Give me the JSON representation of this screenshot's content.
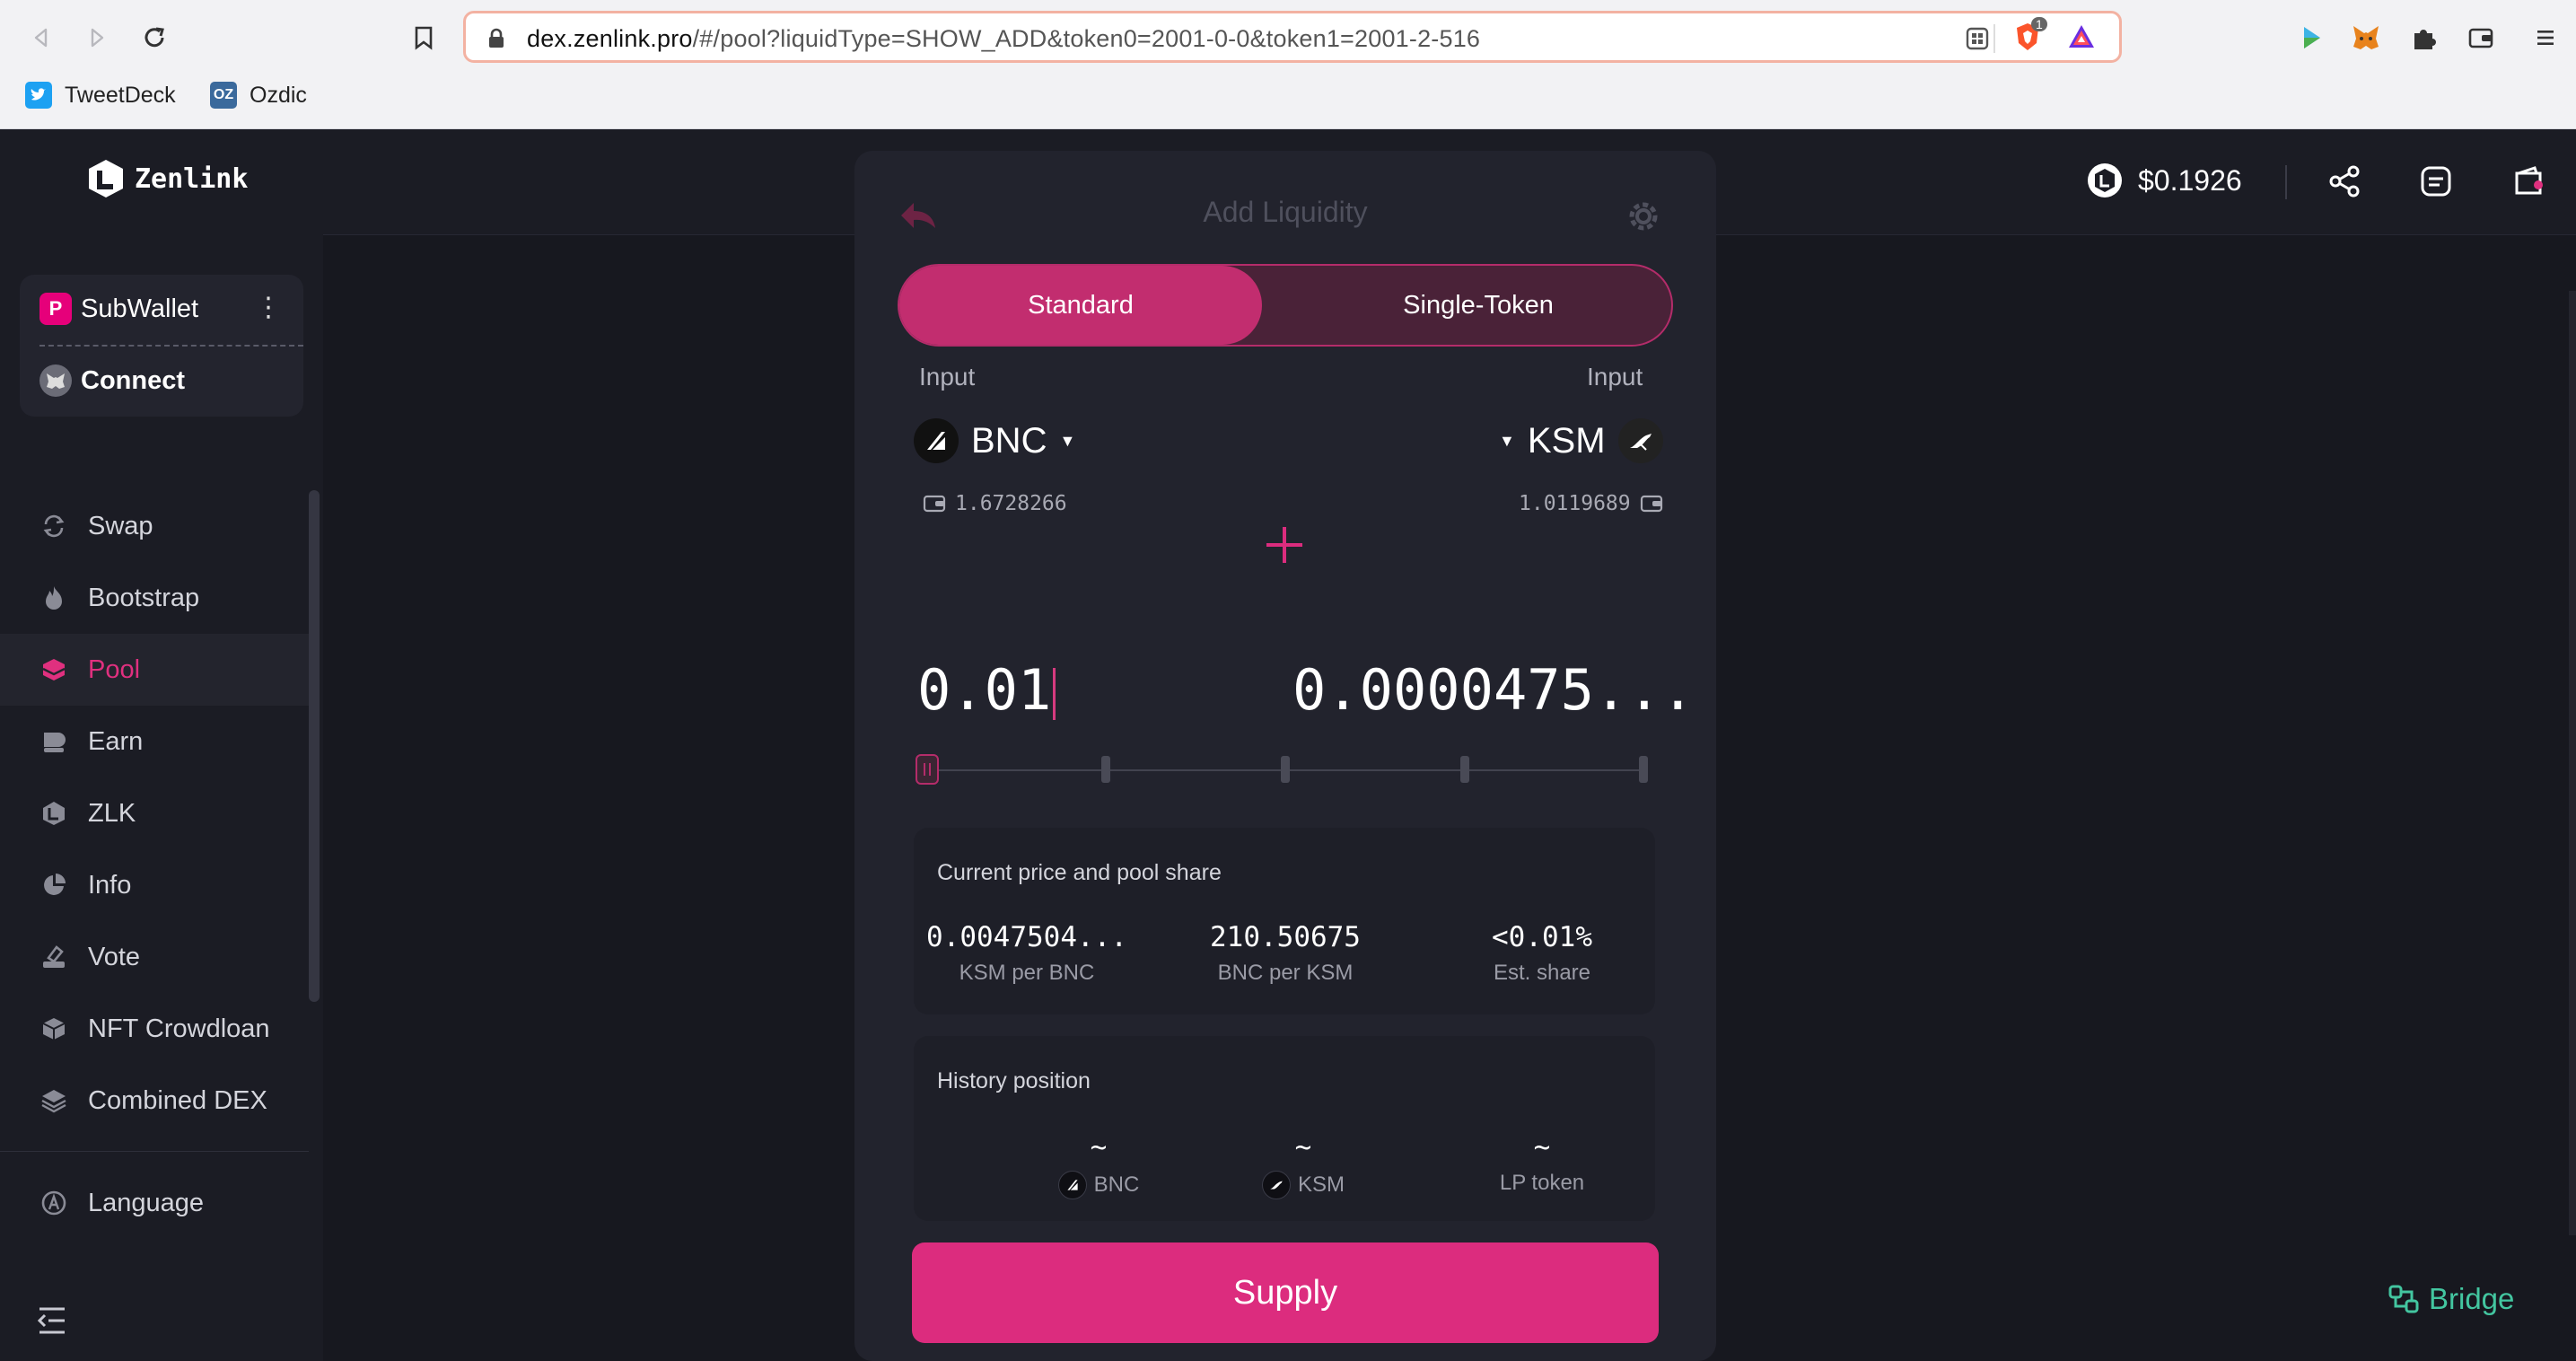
{
  "browser": {
    "url_host": "dex.zenlink.pro",
    "url_path": "/#/pool?liquidType=SHOW_ADD&token0=2001-0-0&token1=2001-2-516",
    "extension_badge": "1",
    "bookmarks": [
      {
        "label": "TweetDeck",
        "icon": "tweetdeck-icon",
        "color": "#1da1f2"
      },
      {
        "label": "Ozdic",
        "icon": "ozdic-icon",
        "color": "#3b6a9c"
      }
    ]
  },
  "app": {
    "brand": "Zenlink",
    "price": "$0.1926",
    "accent": "#dc2c7e",
    "wallet": {
      "name": "SubWallet",
      "connect_label": "Connect"
    },
    "menu": [
      {
        "label": "Swap",
        "icon": "swap-icon"
      },
      {
        "label": "Bootstrap",
        "icon": "flame-icon"
      },
      {
        "label": "Pool",
        "icon": "pool-icon",
        "active": true
      },
      {
        "label": "Earn",
        "icon": "earn-icon"
      },
      {
        "label": "ZLK",
        "icon": "zlk-icon"
      },
      {
        "label": "Info",
        "icon": "pie-icon"
      },
      {
        "label": "Vote",
        "icon": "vote-icon"
      },
      {
        "label": "NFT Crowdloan",
        "icon": "cube-icon"
      },
      {
        "label": "Combined DEX",
        "icon": "layers-icon"
      }
    ],
    "language_label": "Language",
    "bridge_label": "Bridge"
  },
  "panel": {
    "title": "Add Liquidity",
    "tabs": {
      "standard": "Standard",
      "single": "Single-Token"
    },
    "input_label_left": "Input",
    "input_label_right": "Input",
    "token0": {
      "symbol": "BNC",
      "balance": "1.6728266"
    },
    "token1": {
      "symbol": "KSM",
      "balance": "1.0119689"
    },
    "amount0": "0.01",
    "amount1": "0.0000475...",
    "slider_percent": 0,
    "price_card": {
      "title": "Current price and pool share",
      "stats": [
        {
          "value": "0.0047504...",
          "label": "KSM per BNC"
        },
        {
          "value": "210.50675",
          "label": "BNC per KSM"
        },
        {
          "value": "<0.01%",
          "label": "Est. share"
        }
      ]
    },
    "history_card": {
      "title": "History position",
      "stats": [
        {
          "value": "~",
          "label": "BNC"
        },
        {
          "value": "~",
          "label": "KSM"
        },
        {
          "value": "~",
          "label": "LP token"
        }
      ]
    },
    "supply_label": "Supply"
  }
}
